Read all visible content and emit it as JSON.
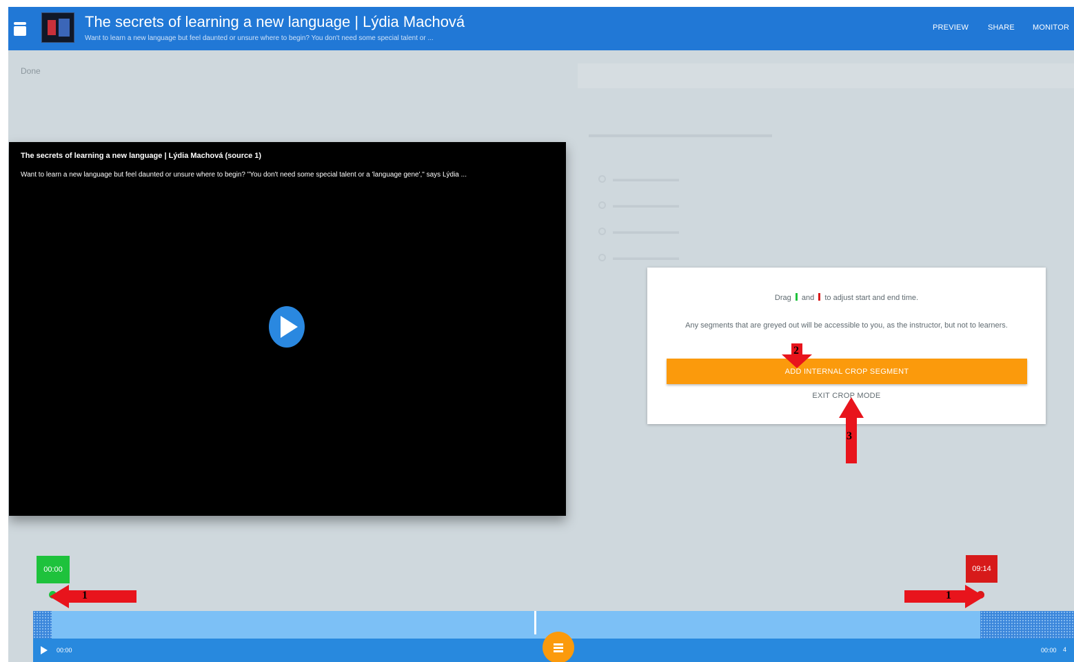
{
  "header": {
    "title": "The secrets of learning a new language | Lýdia Machová",
    "subtitle": "Want to learn a new language but feel daunted or unsure where to begin? You don't need some special talent or ...",
    "actions": [
      {
        "label": "PREVIEW"
      },
      {
        "label": "SHARE"
      },
      {
        "label": "MONITOR"
      }
    ]
  },
  "done_label": "Done",
  "video": {
    "title": "The secrets of learning a new language | Lýdia Machová (source 1)",
    "description": "Want to learn a new language but feel daunted or unsure where to begin? \"You don't need some special talent or a 'language gene',\" says Lýdia ..."
  },
  "crop_card": {
    "instruction_prefix": "Drag",
    "instruction_and": "and",
    "instruction_suffix": "to adjust start and end time.",
    "note": "Any segments that are greyed out will be accessible to you, as the instructor, but not to learners.",
    "add_button": "ADD INTERNAL CROP SEGMENT",
    "exit_button": "EXIT CROP MODE",
    "start_marker_color": "#1ec23c",
    "end_marker_color": "#d71a1a"
  },
  "timeline": {
    "start_time": "00:00",
    "end_time": "09:14",
    "current_time": "00:00",
    "duration_time": "00:00",
    "volume_glyph": "4"
  },
  "annotations": [
    {
      "number": "1"
    },
    {
      "number": "1"
    },
    {
      "number": "2"
    },
    {
      "number": "3"
    }
  ],
  "colors": {
    "header": "#2178d6",
    "accent_orange": "#fb9a0c",
    "start_green": "#1ec23c",
    "end_red": "#d71a1a",
    "track": "#7cc0f6",
    "arrow_red": "#e8141c"
  },
  "icons": [
    "menu-icon",
    "play-icon",
    "scissors-icon",
    "annotation-arrow"
  ]
}
